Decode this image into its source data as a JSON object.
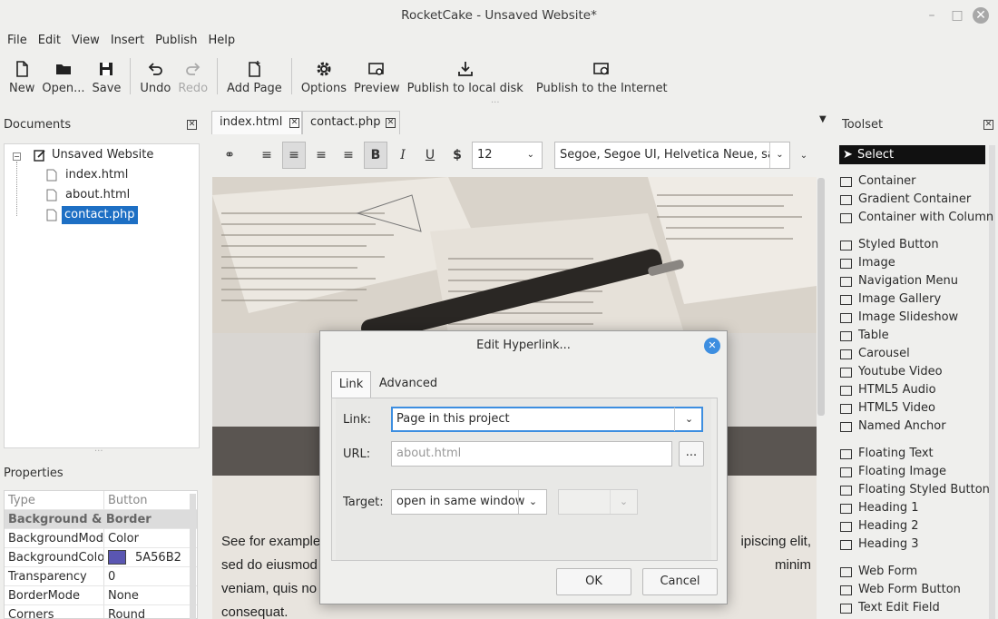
{
  "window": {
    "title": "RocketCake - Unsaved Website*"
  },
  "menu": [
    "File",
    "Edit",
    "View",
    "Insert",
    "Publish",
    "Help"
  ],
  "toolbar": {
    "new": "New",
    "open": "Open...",
    "save": "Save",
    "undo": "Undo",
    "redo": "Redo",
    "add_page": "Add Page",
    "options": "Options",
    "preview": "Preview",
    "publish_local": "Publish to local disk",
    "publish_internet": "Publish to the Internet"
  },
  "documents": {
    "title": "Documents",
    "root": "Unsaved Website",
    "items": [
      "index.html",
      "about.html",
      "contact.php"
    ],
    "selected": "contact.php"
  },
  "properties": {
    "title": "Properties",
    "header": {
      "key": "Type",
      "value": "Button"
    },
    "section": "Background & Border",
    "rows": [
      {
        "key": "BackgroundMode",
        "value": "Color"
      },
      {
        "key": "BackgroundColor",
        "value": "5A56B2"
      },
      {
        "key": "Transparency",
        "value": "0"
      },
      {
        "key": "BorderMode",
        "value": "None"
      },
      {
        "key": "Corners",
        "value": "Round"
      }
    ],
    "color_swatch": "#5A56B2"
  },
  "editor": {
    "tabs": [
      "index.html",
      "contact.php"
    ],
    "font_size": "12",
    "font_family": "Segoe, Segoe UI, Helvetica Neue, sans",
    "body_text": {
      "line1_left": "See for example",
      "line1_right": "ipiscing elit,",
      "line2_left": "sed do eiusmod",
      "line2_right": "minim",
      "line3_left": "veniam, quis no",
      "line4": "consequat."
    }
  },
  "toolset": {
    "title": "Toolset",
    "select": "Select",
    "groups": [
      [
        "Container",
        "Gradient Container",
        "Container with Column"
      ],
      [
        "Styled Button",
        "Image",
        "Navigation Menu",
        "Image Gallery",
        "Image Slideshow",
        "Table",
        "Carousel",
        "Youtube Video",
        "HTML5 Audio",
        "HTML5 Video",
        "Named Anchor"
      ],
      [
        "Floating Text",
        "Floating Image",
        "Floating Styled Button",
        "Heading 1",
        "Heading 2",
        "Heading 3"
      ],
      [
        "Web Form",
        "Web Form Button",
        "Text Edit Field"
      ]
    ]
  },
  "dialog": {
    "title": "Edit Hyperlink...",
    "tabs": [
      "Link",
      "Advanced"
    ],
    "link_label": "Link:",
    "link_value": "Page in this project",
    "url_label": "URL:",
    "url_value": "about.html",
    "browse": "...",
    "target_label": "Target:",
    "target_value": "open in same window",
    "ok": "OK",
    "cancel": "Cancel"
  },
  "colors": {
    "selection": "#1d6fc4",
    "accent": "#3d8ee0"
  }
}
